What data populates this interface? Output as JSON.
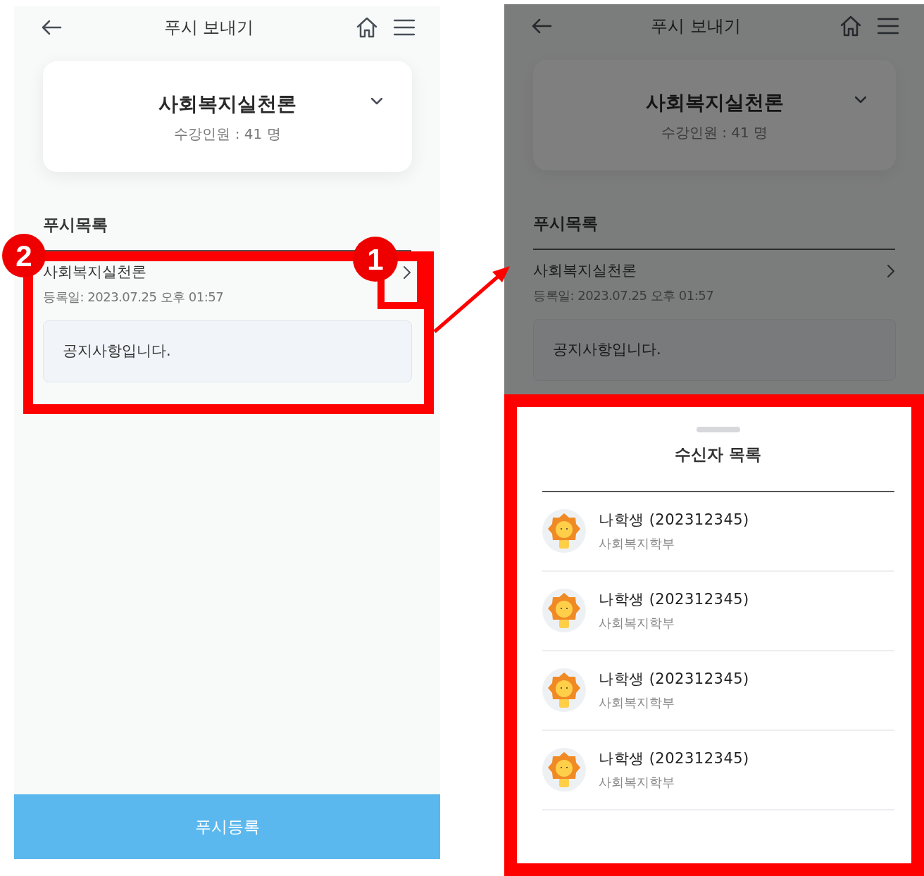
{
  "screens": [
    {
      "header": {
        "title": "푸시 보내기"
      },
      "course": {
        "name": "사회복지실천론",
        "enrollment": "수강인원 : 41 명"
      },
      "section_title": "푸시목록",
      "push_items": [
        {
          "title": "사회복지실천론",
          "date": "등록일: 2023.07.25 오후 01:57",
          "message": "공지사항입니다."
        }
      ],
      "register_button": "푸시등록",
      "dimmed": false
    },
    {
      "header": {
        "title": "푸시 보내기"
      },
      "course": {
        "name": "사회복지실천론",
        "enrollment": "수강인원 : 41 명"
      },
      "section_title": "푸시목록",
      "push_items": [
        {
          "title": "사회복지실천론",
          "date": "등록일: 2023.07.25 오후 01:57",
          "message": "공지사항입니다."
        }
      ],
      "dimmed": true,
      "sheet": {
        "title": "수신자 목록",
        "recipients": [
          {
            "name": "나학생 (202312345)",
            "department": "사회복지학부"
          },
          {
            "name": "나학생 (202312345)",
            "department": "사회복지학부"
          },
          {
            "name": "나학생 (202312345)",
            "department": "사회복지학부"
          },
          {
            "name": "나학생 (202312345)",
            "department": "사회복지학부"
          }
        ]
      }
    }
  ],
  "annotations": {
    "markers": [
      {
        "label": "2"
      },
      {
        "label": "1"
      }
    ]
  }
}
